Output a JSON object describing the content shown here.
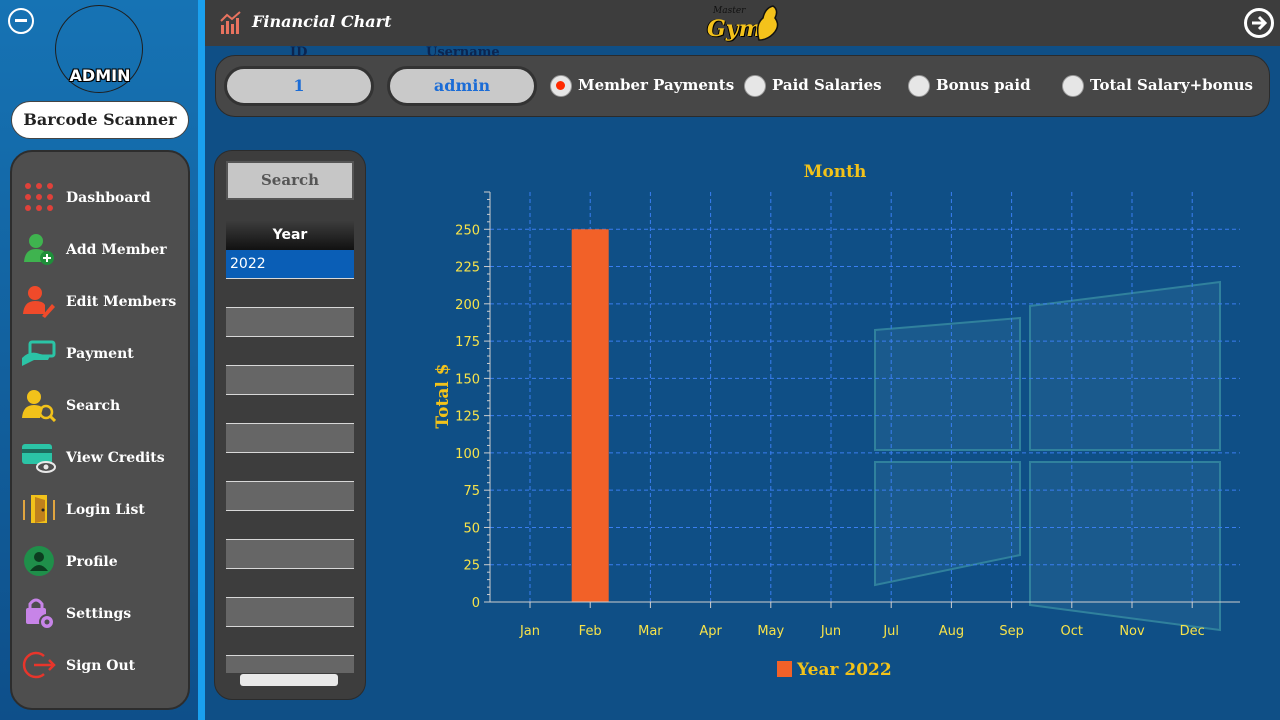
{
  "sidebar": {
    "admin_label": "ADMIN",
    "barcode_button": "Barcode Scanner",
    "menu": [
      {
        "label": "Dashboard",
        "icon": "grid-dots-icon"
      },
      {
        "label": "Add Member",
        "icon": "add-user-icon"
      },
      {
        "label": "Edit Members",
        "icon": "edit-user-icon"
      },
      {
        "label": "Payment",
        "icon": "payment-hand-icon"
      },
      {
        "label": "Search",
        "icon": "search-user-icon"
      },
      {
        "label": "View Credits",
        "icon": "credit-card-eye-icon"
      },
      {
        "label": "Login List",
        "icon": "door-icon"
      },
      {
        "label": "Profile",
        "icon": "profile-icon"
      },
      {
        "label": "Settings",
        "icon": "lock-gear-icon"
      },
      {
        "label": "Sign Out",
        "icon": "sign-out-icon"
      }
    ]
  },
  "header": {
    "title": "Financial Chart",
    "logo_small": "Master",
    "logo_main": "Gym"
  },
  "toolbar": {
    "id_caption": "ID",
    "id_value": "1",
    "username_caption": "Username",
    "username_value": "admin",
    "options": [
      {
        "label": "Member Payments",
        "selected": true
      },
      {
        "label": "Paid Salaries",
        "selected": false
      },
      {
        "label": "Bonus paid",
        "selected": false
      },
      {
        "label": "Total Salary+bonus",
        "selected": false
      }
    ]
  },
  "year_panel": {
    "search_label": "Search",
    "header": "Year",
    "rows": [
      "2022"
    ]
  },
  "colors": {
    "bar": "#f26128",
    "axis_text": "#f7e34a",
    "title_text": "#f2c21a",
    "grid": "#3a7ef0"
  },
  "chart_data": {
    "type": "bar",
    "title": "Month",
    "ylabel": "Total $",
    "xlabel": "",
    "categories": [
      "Jan",
      "Feb",
      "Mar",
      "Apr",
      "May",
      "Jun",
      "Jul",
      "Aug",
      "Sep",
      "Oct",
      "Nov",
      "Dec"
    ],
    "series": [
      {
        "name": "Year 2022",
        "values": [
          0,
          250,
          0,
          0,
          0,
          0,
          0,
          0,
          0,
          0,
          0,
          0
        ]
      }
    ],
    "yticks": [
      0,
      25,
      50,
      75,
      100,
      125,
      150,
      175,
      200,
      225,
      250
    ],
    "ylim": [
      0,
      275
    ],
    "grid": true,
    "legend": "bottom"
  }
}
